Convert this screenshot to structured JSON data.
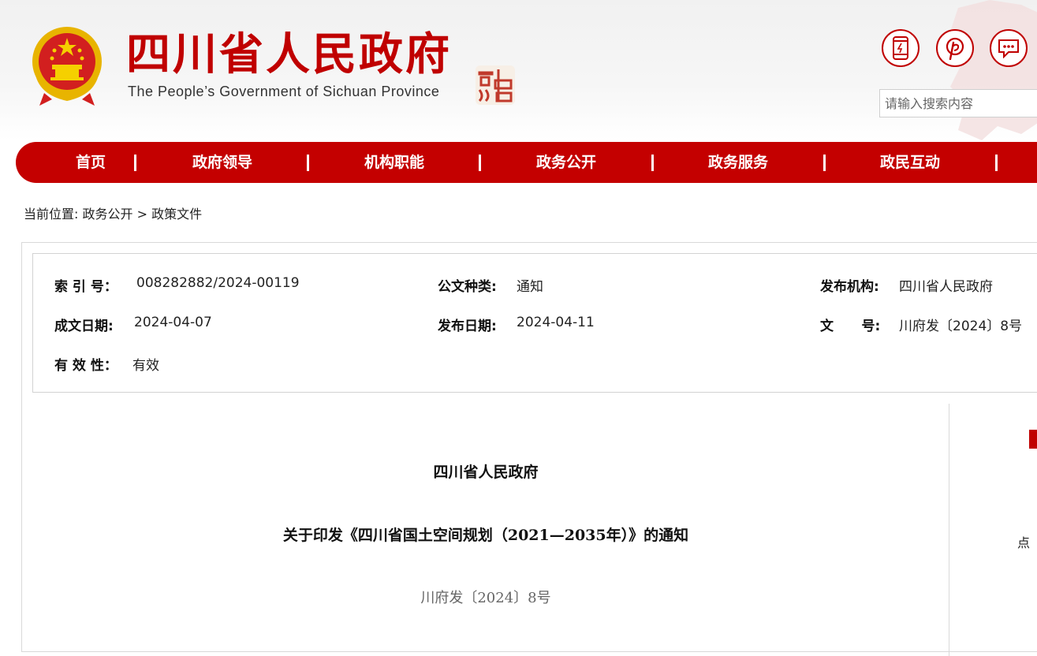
{
  "header": {
    "site_title": "四川省人民政府",
    "site_subtitle": "The People’s Government of Sichuan Province",
    "seal_text": "四川中國",
    "icons": [
      "mobile-icon",
      "weibo-icon",
      "message-icon"
    ],
    "search": {
      "placeholder": "请输入搜索内容"
    }
  },
  "nav": {
    "items": [
      "首页",
      "政府领导",
      "机构职能",
      "政务公开",
      "政务服务",
      "政民互动"
    ]
  },
  "breadcrumb": {
    "label": "当前位置:",
    "items": [
      "政务公开",
      "政策文件"
    ],
    "separator": ">"
  },
  "meta": {
    "index_label": "索 引 号：",
    "index_value": "008282882/2024-00119",
    "type_label": "公文种类:",
    "type_value": "通知",
    "publisher_label": "发布机构:",
    "publisher_value": "四川省人民政府",
    "written_label": "成文日期:",
    "written_value": "2024-04-07",
    "published_label": "发布日期:",
    "published_value": "2024-04-11",
    "docno_label": "文      号:",
    "docno_value": "川府发〔2024〕8号",
    "validity_label": "有 效 性：",
    "validity_value": "有效"
  },
  "document": {
    "issuer": "四川省人民政府",
    "title": "关于印发《四川省国土空间规划（2021—2035年）》的通知",
    "doc_number": "川府发〔2024〕8号"
  },
  "sidebar": {
    "partial_text": "点"
  },
  "colors": {
    "brand_red": "#c40000",
    "border": "#d9d9d9"
  }
}
